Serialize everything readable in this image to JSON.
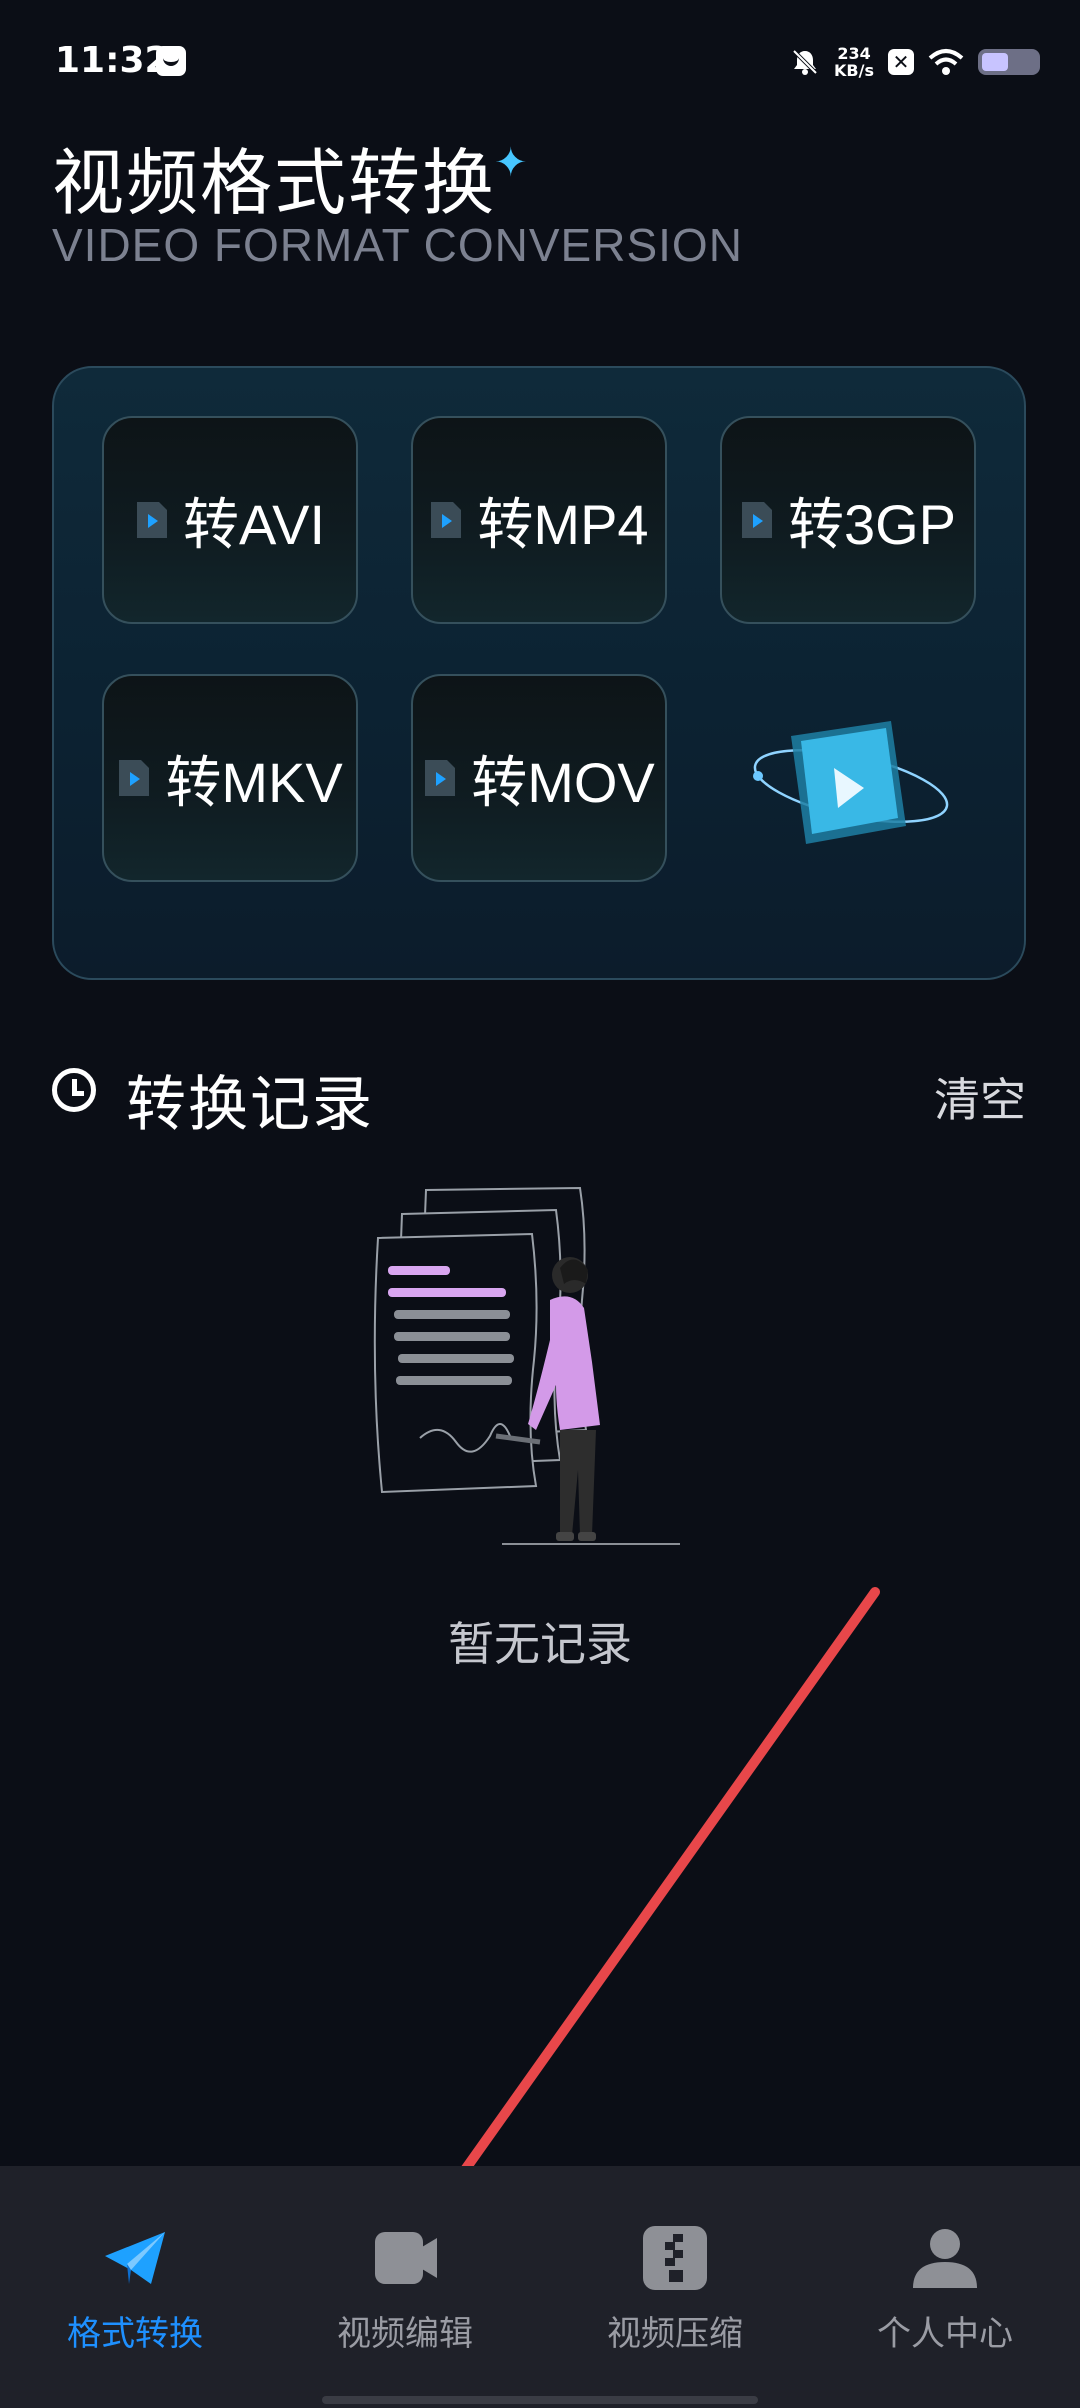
{
  "status_bar": {
    "time": "11:32",
    "net_speed_value": "234",
    "net_speed_unit": "KB/s"
  },
  "header": {
    "title": "视频格式转换",
    "subtitle": "VIDEO FORMAT CONVERSION"
  },
  "formats": [
    {
      "label": "转AVI"
    },
    {
      "label": "转MP4"
    },
    {
      "label": "转3GP"
    },
    {
      "label": "转MKV"
    },
    {
      "label": "转MOV"
    }
  ],
  "history": {
    "title": "转换记录",
    "clear_label": "清空",
    "empty_text": "暂无记录"
  },
  "bottom_nav": [
    {
      "label": "格式转换",
      "icon": "paper-plane-icon",
      "active": true
    },
    {
      "label": "视频编辑",
      "icon": "video-edit-icon",
      "active": false
    },
    {
      "label": "视频压缩",
      "icon": "zip-icon",
      "active": false
    },
    {
      "label": "个人中心",
      "icon": "person-icon",
      "active": false
    }
  ],
  "colors": {
    "background": "#0b0e16",
    "accent_active": "#1e90ff",
    "panel_border": "#2b4a5c",
    "annotation_arrow": "#e8474a"
  }
}
